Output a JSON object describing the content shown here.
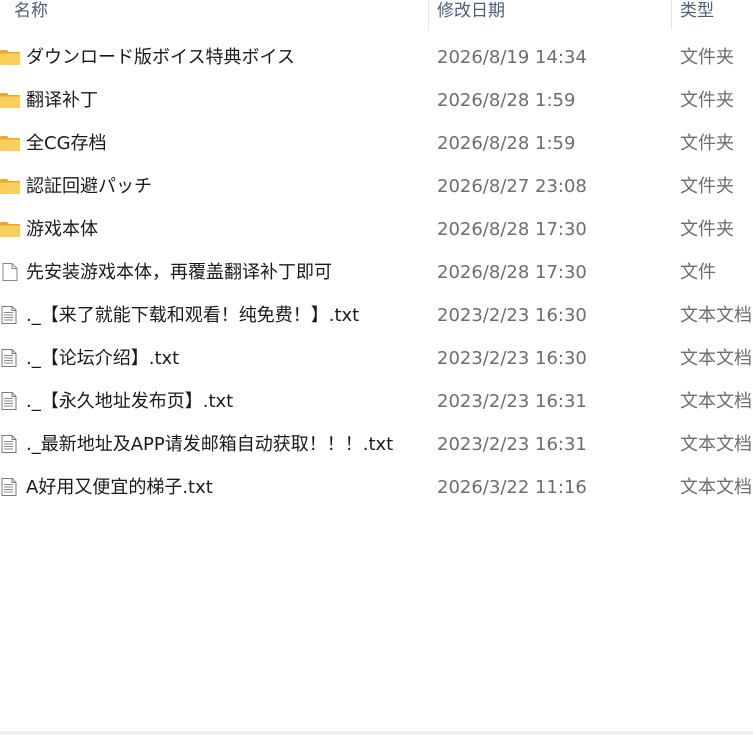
{
  "header": {
    "name": "名称",
    "date": "修改日期",
    "type": "类型"
  },
  "colors": {
    "header_text": "#4c607a",
    "folder": "#f5c542",
    "secondary_text": "#6d6d6d"
  },
  "files": [
    {
      "icon": "folder-icon",
      "name": "ダウンロード版ボイス特典ボイス",
      "date": "2026/8/19 14:34",
      "type": "文件夹"
    },
    {
      "icon": "folder-icon",
      "name": "翻译补丁",
      "date": "2026/8/28 1:59",
      "type": "文件夹"
    },
    {
      "icon": "folder-icon",
      "name": "全CG存档",
      "date": "2026/8/28 1:59",
      "type": "文件夹"
    },
    {
      "icon": "folder-icon",
      "name": "認証回避パッチ",
      "date": "2026/8/27 23:08",
      "type": "文件夹"
    },
    {
      "icon": "folder-icon",
      "name": "游戏本体",
      "date": "2026/8/28 17:30",
      "type": "文件夹"
    },
    {
      "icon": "file-icon",
      "name": "先安装游戏本体，再覆盖翻译补丁即可",
      "date": "2026/8/28 17:30",
      "type": "文件"
    },
    {
      "icon": "text-file-icon",
      "name": "._【来了就能下载和观看！纯免费！】.txt",
      "date": "2023/2/23 16:30",
      "type": "文本文档"
    },
    {
      "icon": "text-file-icon",
      "name": "._【论坛介绍】.txt",
      "date": "2023/2/23 16:30",
      "type": "文本文档"
    },
    {
      "icon": "text-file-icon",
      "name": "._【永久地址发布页】.txt",
      "date": "2023/2/23 16:31",
      "type": "文本文档"
    },
    {
      "icon": "text-file-icon",
      "name": "._最新地址及APP请发邮箱自动获取！！！.txt",
      "date": "2023/2/23 16:31",
      "type": "文本文档"
    },
    {
      "icon": "text-file-icon",
      "name": "A好用又便宜的梯子.txt",
      "date": "2026/3/22 11:16",
      "type": "文本文档"
    }
  ]
}
